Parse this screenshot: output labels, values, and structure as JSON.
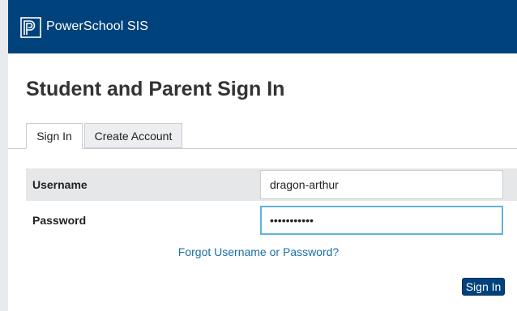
{
  "header": {
    "brand": "PowerSchool SIS",
    "logo_icon": "powerschool-p-logo-icon"
  },
  "page_title": "Student and Parent Sign In",
  "tabs": [
    {
      "label": "Sign In",
      "active": true
    },
    {
      "label": "Create Account",
      "active": false
    }
  ],
  "form": {
    "username_label": "Username",
    "username_value": "dragon-arthur",
    "password_label": "Password",
    "password_value": "•••••••••••",
    "forgot_link": "Forgot Username or Password?",
    "submit_label": "Sign In"
  },
  "colors": {
    "header_bg": "#00427c",
    "link": "#1b6ea8",
    "focus_border": "#5fb3dd",
    "row_bg": "#e5e7e9"
  }
}
